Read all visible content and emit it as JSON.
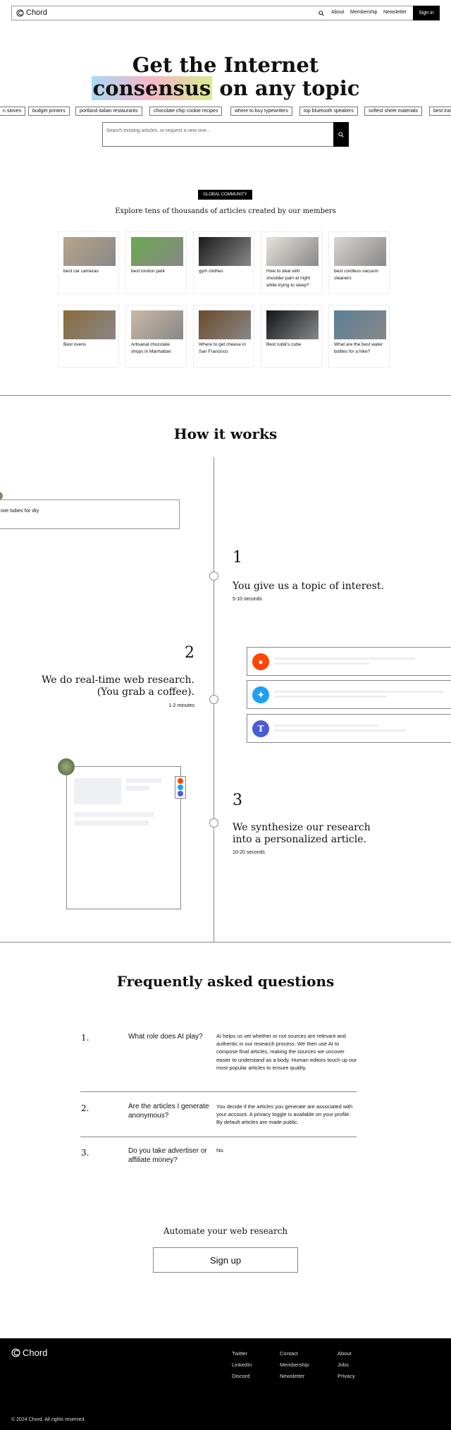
{
  "nav": {
    "logo": "Chord",
    "links": [
      "About",
      "Membership",
      "Newsletter"
    ],
    "signin": "Sign in",
    "search_icon": "search-icon"
  },
  "hero": {
    "line1": "Get the Internet",
    "highlight": "consensus",
    "line2_rest": " on any topic"
  },
  "topics": [
    "n stoves",
    "budget printers",
    "portland italian restaurants",
    "chocolate chip cookie recipes",
    "where to buy typewriters",
    "top bluetooth speakers",
    "softest sheet materials",
    "best trav"
  ],
  "search": {
    "placeholder": "Search existing articles, or request a new one..."
  },
  "community": {
    "badge": "GLOBAL COMMUNITY",
    "subtitle": "Explore tens of thousands of articles created by our members",
    "articles": [
      {
        "title": "best car cameras",
        "color": "#b9a58a"
      },
      {
        "title": "best london park",
        "color": "#6aa84f"
      },
      {
        "title": "gym clothes",
        "color": "#1a1a1a"
      },
      {
        "title": "How to deal with shoulder pain at night while trying to sleep?",
        "color": "#e8e2dc"
      },
      {
        "title": "best cordless vacuum cleaners",
        "color": "#d9d6d1"
      },
      {
        "title": "Best ovens",
        "color": "#8a6a3a"
      },
      {
        "title": "Artisanal chocolate shops in Manhattan",
        "color": "#c9b8a6"
      },
      {
        "title": "Where to get cheese in San Francisco",
        "color": "#6b4a2a"
      },
      {
        "title": "Best rubik's cube",
        "color": "#101418"
      },
      {
        "title": "What are the best water bottles for a hike?",
        "color": "#5b7f99"
      }
    ]
  },
  "how": {
    "title": "How it works",
    "example_topic": "ixie tubes for diy",
    "steps": [
      {
        "num": "1",
        "text": "You give us a topic of interest.",
        "time": "5-10 seconds"
      },
      {
        "num": "2",
        "text1": "We do real-time web research.",
        "text2": "(You grab a coffee).",
        "time": "1-2 minutes"
      },
      {
        "num": "3",
        "text1": "We synthesize our research",
        "text2": "into a personalized article.",
        "time": "10-20 seconds"
      }
    ],
    "sources": [
      {
        "icon": "reddit-icon",
        "color": "#ff4500"
      },
      {
        "icon": "twitter-icon",
        "color": "#1da1f2"
      },
      {
        "icon": "nytimes-icon",
        "color": "#4a5bd6"
      }
    ]
  },
  "faq": {
    "title": "Frequently asked questions",
    "items": [
      {
        "num": "1.",
        "q": "What role does AI play?",
        "a": "AI helps us vet whether or not sources are relevant and authentic in our research process. We then use AI to compose final articles, making the sources we uncover easier to understand as a body. Human editors touch up our most popular articles to ensure quality."
      },
      {
        "num": "2.",
        "q": "Are the articles I generate anonymous?",
        "a": "You decide if the articles you generate are associated with your account. A privacy toggle is available on your profile. By default articles are made public."
      },
      {
        "num": "3.",
        "q": "Do you take advertiser or affiliate money?",
        "a": "No."
      }
    ]
  },
  "cta": {
    "title": "Automate your web research",
    "button": "Sign up"
  },
  "footer": {
    "logo": "Chord",
    "cols": [
      [
        "Twitter",
        "LinkedIn",
        "Discord"
      ],
      [
        "Contact",
        "Membership",
        "Newsletter"
      ],
      [
        "About",
        "Jobs",
        "Privacy"
      ]
    ],
    "copyright": "© 2024 Chord. All rights reserved."
  }
}
